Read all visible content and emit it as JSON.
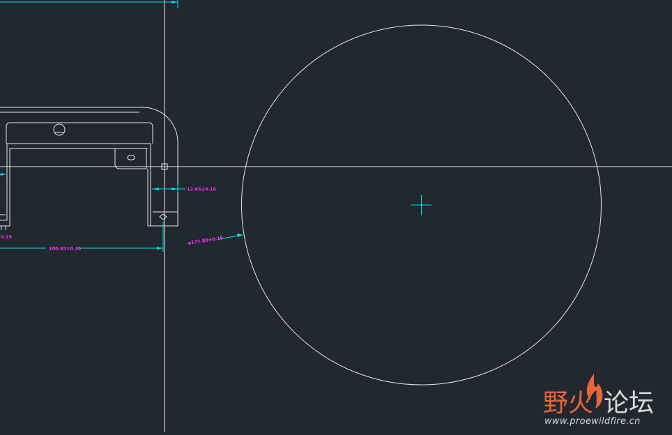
{
  "colors": {
    "background": "#212830",
    "geometry": "#e6e8ea",
    "dimension_line": "#00e5e5",
    "dimension_text": "#ff33ff",
    "watermark_orange": "#e8663a",
    "watermark_gray": "#d8d8d8"
  },
  "dimensions": {
    "left_partial": "0.15",
    "width": "180.45±0.15",
    "wall": "13.85±0.15",
    "circle_diameter": "ø177.80±0.15"
  },
  "watermark": {
    "title_part1": "野火",
    "title_part2": "论坛",
    "url": "www.proewildfire.cn"
  },
  "icons": {
    "center_mark": "crosshair-icon",
    "cursor": "pickbox-icon",
    "watermark_flame": "flame-icon"
  }
}
